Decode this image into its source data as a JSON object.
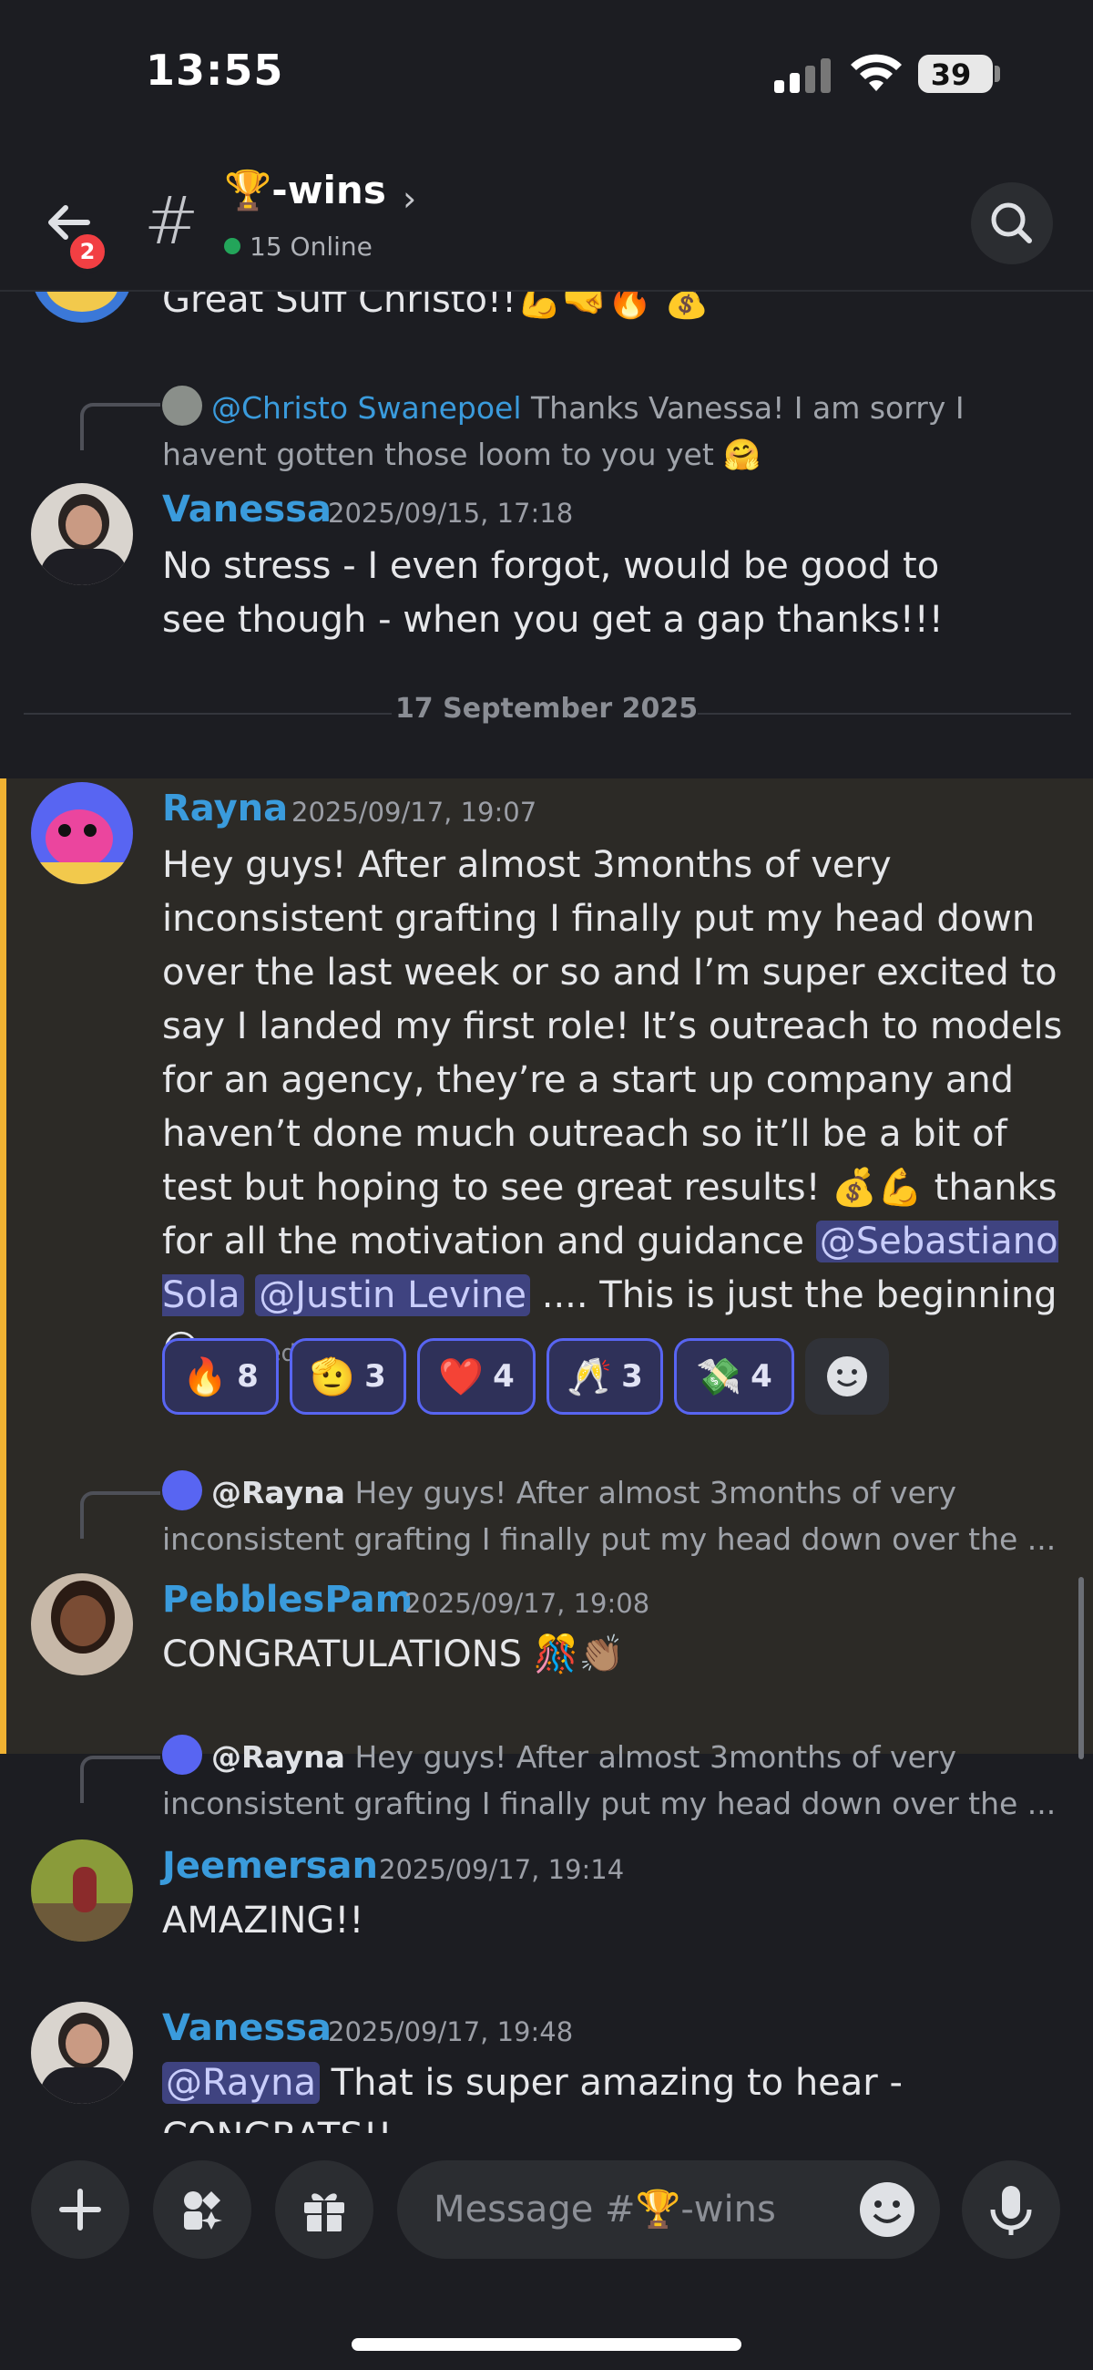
{
  "status_bar": {
    "time": "13:55",
    "battery": "39"
  },
  "header": {
    "notification_count": "2",
    "channel_name": "🏆-wins",
    "online": "15 Online"
  },
  "messages": {
    "top_partial": {
      "text": "Great Suff Christo!!💪🤜🔥 💰"
    },
    "vanessa1": {
      "reply_name": "@Christo Swanepoel",
      "reply_text": "Thanks Vanessa! I am sorry I havent gotten those loom to you yet 🤗",
      "username": "Vanessa",
      "timestamp": "2025/09/15, 17:18",
      "text": "No stress - I even forgot, would be good to see though - when you get a gap thanks!!!"
    },
    "date_divider": "17 September 2025",
    "rayna": {
      "username": "Rayna",
      "timestamp": "2025/09/17, 19:07",
      "text_part1": "Hey guys! After almost 3months of very inconsistent grafting I finally put my head down over the last week or so and I’m super excited to say I landed my first role! It’s outreach to models for an agency, they’re a start up company and haven’t done much outreach so it’ll be a bit of test but hoping to see great results! 💰💪 thanks for all the motivation and guidance",
      "mention1": "@Sebastiano Sola",
      "mention2": "@Justin Levine",
      "text_part2": ".... This is just the beginning 😄",
      "edited": "(edited)",
      "reactions": [
        {
          "emoji": "🔥",
          "count": "8"
        },
        {
          "emoji": "🫡",
          "count": "3"
        },
        {
          "emoji": "❤️",
          "count": "4"
        },
        {
          "emoji": "🥂",
          "count": "3"
        },
        {
          "emoji": "💸",
          "count": "4"
        }
      ]
    },
    "pebblespam": {
      "reply_name": "@Rayna",
      "reply_text": "Hey guys! After almost 3months of very inconsistent grafting I finally put my head down over the ...",
      "username": "PebblesPam",
      "timestamp": "2025/09/17, 19:08",
      "text": "CONGRATULATIONS 🎊👏🏽"
    },
    "jeemersan": {
      "reply_name": "@Rayna",
      "reply_text": "Hey guys! After almost 3months of very inconsistent grafting I finally put my head down over the ...",
      "username": "Jeemersan",
      "timestamp": "2025/09/17, 19:14",
      "text": "AMAZING!!"
    },
    "vanessa2": {
      "username": "Vanessa",
      "timestamp": "2025/09/17, 19:48",
      "mention": "@Rayna",
      "text": " That is super amazing to hear - CONGRATS!!"
    }
  },
  "input": {
    "placeholder": "Message #🏆-wins"
  },
  "colors": {
    "mention_bg": "#3f4380",
    "username": "#3a9bdc",
    "highlight_border": "#f0b232",
    "reaction_border": "#5865f2"
  }
}
